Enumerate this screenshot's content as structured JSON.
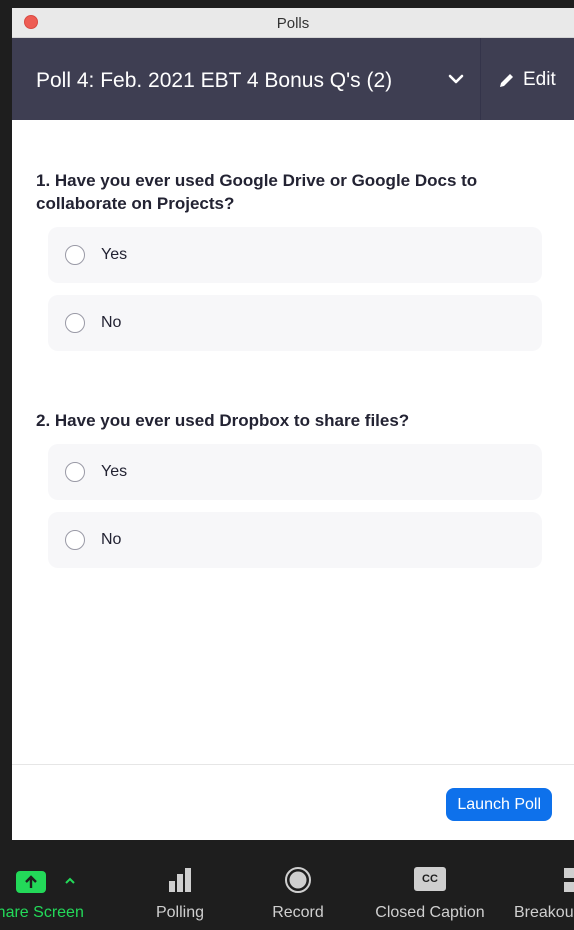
{
  "window": {
    "title": "Polls"
  },
  "header": {
    "poll_title": "Poll 4: Feb. 2021 EBT 4 Bonus Q's (2)",
    "edit_label": "Edit"
  },
  "questions": [
    {
      "text": "1. Have you ever used Google Drive or Google Docs to collaborate on Projects?",
      "options": [
        "Yes",
        "No"
      ]
    },
    {
      "text": "2. Have you ever used Dropbox to share files?",
      "options": [
        "Yes",
        "No"
      ]
    }
  ],
  "footer": {
    "launch_label": "Launch Poll"
  },
  "toolbar": {
    "items": [
      {
        "label": "Share Screen",
        "icon": "share-screen-icon",
        "color": "#23d959"
      },
      {
        "label": "Polling",
        "icon": "polling-icon"
      },
      {
        "label": "Record",
        "icon": "record-icon"
      },
      {
        "label": "Closed Caption",
        "icon": "closed-caption-icon",
        "badge": "CC"
      },
      {
        "label": "Breakou",
        "icon": "breakout-rooms-icon"
      }
    ]
  },
  "colors": {
    "header_bg": "#3e3e52",
    "accent": "#0e71eb",
    "share_green": "#23d959"
  }
}
